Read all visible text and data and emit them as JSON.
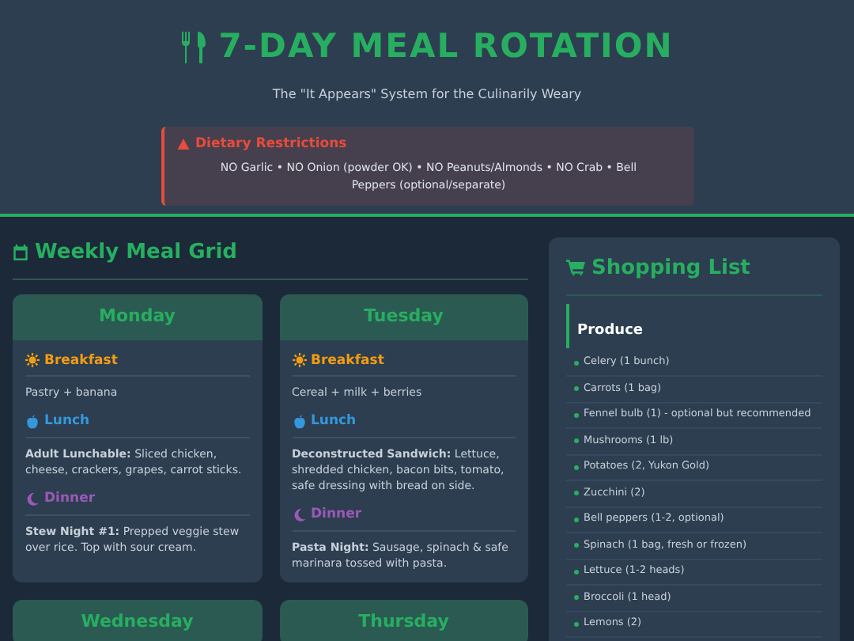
{
  "header": {
    "title": "7-DAY MEAL ROTATION",
    "subtitle": "The \"It Appears\" System for the Culinarily Weary",
    "alert": {
      "title": "Dietary Restrictions",
      "text": "NO Garlic • NO Onion (powder OK) • NO Peanuts/Almonds • NO Crab • Bell Peppers (optional/separate)"
    }
  },
  "grid": {
    "title": "Weekly Meal Grid",
    "days": [
      {
        "name": "Monday",
        "meals": [
          {
            "kind": "breakfast",
            "label": "Breakfast",
            "text": "Pastry + banana"
          },
          {
            "kind": "lunch",
            "label": "Lunch",
            "text": "**Adult Lunchable:** Sliced chicken, cheese, crackers, grapes, carrot sticks."
          },
          {
            "kind": "dinner",
            "label": "Dinner",
            "text": "**Stew Night #1:** Prepped veggie stew over rice. Top with sour cream."
          }
        ]
      },
      {
        "name": "Tuesday",
        "meals": [
          {
            "kind": "breakfast",
            "label": "Breakfast",
            "text": "Cereal + milk + berries"
          },
          {
            "kind": "lunch",
            "label": "Lunch",
            "text": "**Deconstructed Sandwich:** Lettuce, shredded chicken, bacon bits, tomato, safe dressing with bread on side."
          },
          {
            "kind": "dinner",
            "label": "Dinner",
            "text": "**Pasta Night:** Sausage, spinach & safe marinara tossed with pasta."
          }
        ]
      },
      {
        "name": "Wednesday"
      },
      {
        "name": "Thursday"
      }
    ]
  },
  "shopping": {
    "title": "Shopping List",
    "sections": [
      {
        "name": "Produce",
        "items": [
          "Celery (1 bunch)",
          "Carrots (1 bag)",
          "Fennel bulb (1) - optional but recommended",
          "Mushrooms (1 lb)",
          "Potatoes (2, Yukon Gold)",
          "Zucchini (2)",
          "Bell peppers (1-2, optional)",
          "Spinach (1 bag, fresh or frozen)",
          "Lettuce (1-2 heads)",
          "Broccoli (1 head)",
          "Lemons (2)"
        ]
      }
    ]
  }
}
